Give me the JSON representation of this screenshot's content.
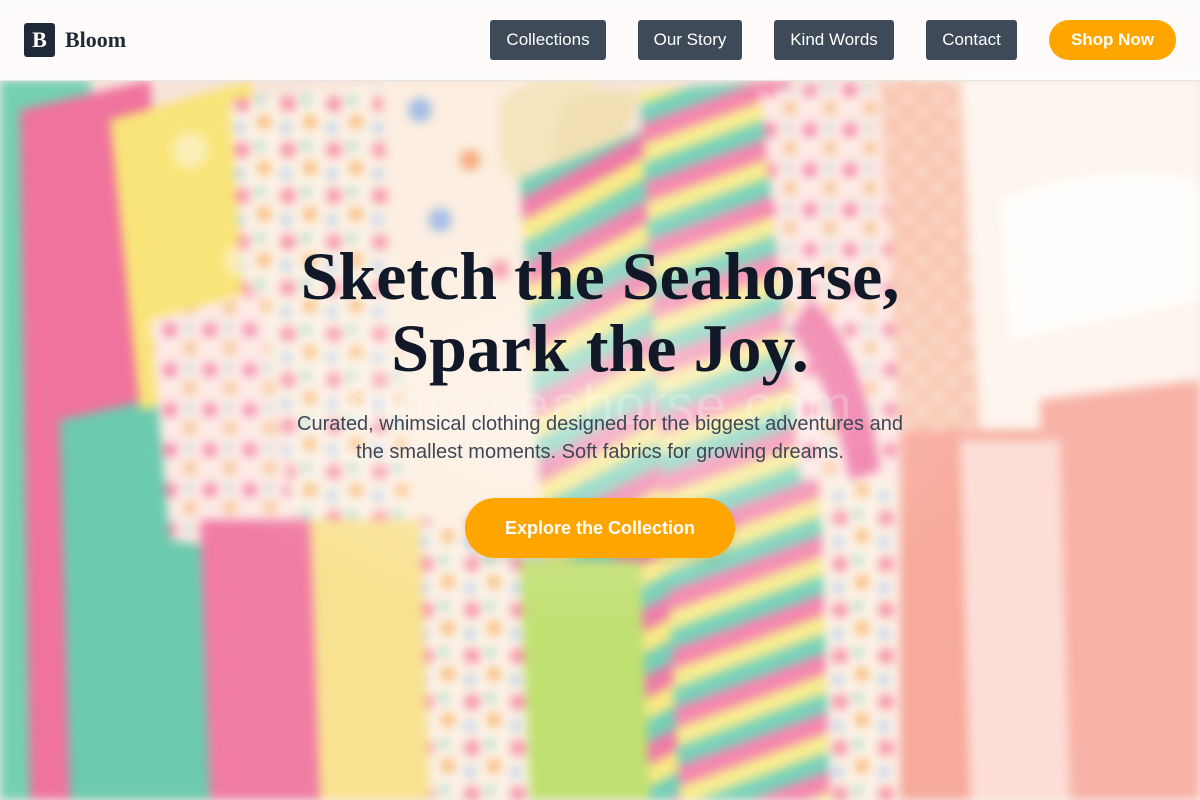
{
  "header": {
    "logo_letter": "B",
    "brand_name": "Bloom",
    "nav": [
      {
        "label": "Collections"
      },
      {
        "label": "Our Story"
      },
      {
        "label": "Kind Words"
      },
      {
        "label": "Contact"
      }
    ],
    "shop_label": "Shop Now"
  },
  "hero": {
    "title_line1": "Sketch the Seahorse,",
    "title_line2": "Spark the Joy.",
    "subtitle_line1": "Curated, whimsical clothing designed for the biggest adventures and",
    "subtitle_line2": "the smallest moments. Soft fabrics for growing dreams.",
    "cta_label": "Explore the Collection",
    "watermark": "funnyseahorse.com"
  },
  "colors": {
    "accent": "#ffa500",
    "nav_button": "#3f4a59",
    "logo_bg": "#1f2937",
    "heading": "#111827"
  }
}
